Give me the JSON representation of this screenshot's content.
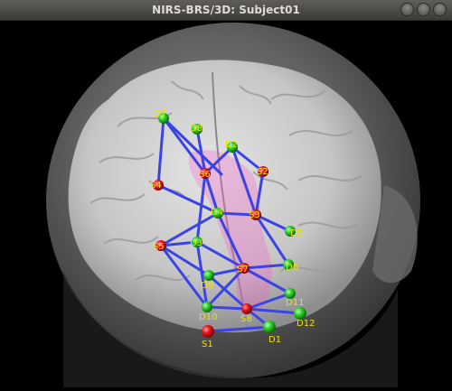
{
  "window": {
    "title": "NIRS-BRS/3D: Subject01"
  },
  "scene": {
    "source_color": "#e8171f",
    "detector_color": "#2fd12b",
    "channel_color": "#3a44e6",
    "label_color": "#e8e400",
    "activation_color": "#ff4fc8",
    "sources": [
      {
        "label": "S1"
      },
      {
        "label": "S3"
      },
      {
        "label": "S4"
      },
      {
        "label": "S5"
      },
      {
        "label": "S6"
      },
      {
        "label": "S7"
      },
      {
        "label": "S8"
      },
      {
        "label": "S2"
      }
    ],
    "detectors": [
      {
        "label": "D1"
      },
      {
        "label": "D2"
      },
      {
        "label": "D3"
      },
      {
        "label": "D4"
      },
      {
        "label": "D5"
      },
      {
        "label": "D6"
      },
      {
        "label": "D7"
      },
      {
        "label": "D8"
      },
      {
        "label": "D9"
      },
      {
        "label": "D10"
      },
      {
        "label": "D11"
      },
      {
        "label": "D12"
      }
    ]
  }
}
